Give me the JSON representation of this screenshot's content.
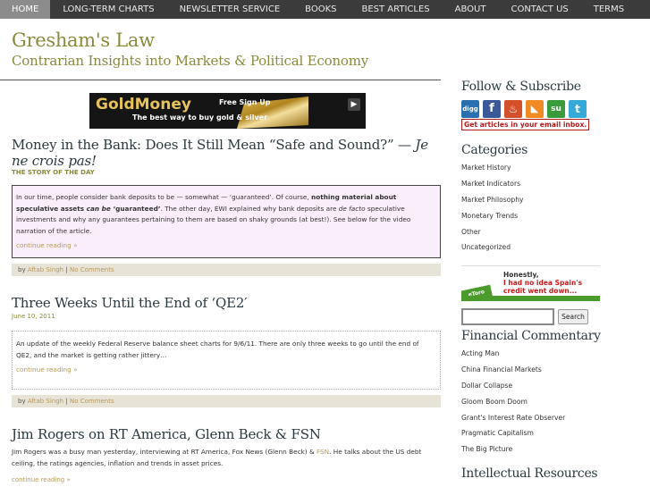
{
  "nav": {
    "items": [
      {
        "label": "HOME"
      },
      {
        "label": "LONG-TERM CHARTS"
      },
      {
        "label": "NEWSLETTER SERVICE"
      },
      {
        "label": "BOOKS"
      },
      {
        "label": "BEST ARTICLES"
      },
      {
        "label": "ABOUT"
      },
      {
        "label": "CONTACT US"
      },
      {
        "label": "TERMS"
      }
    ],
    "active_index": 0
  },
  "site": {
    "title": "Gresham's Law",
    "tagline": "Contrarian Insights into Markets & Political Economy"
  },
  "banner": {
    "logo": "GoldMoney",
    "signup": "Free Sign Up",
    "tagline": "The best way to buy gold & silver"
  },
  "posts": [
    {
      "title_main": "Money in the Bank: Does It Still Mean “Safe and Sound?” — ",
      "title_em": "Je ne crois pas!",
      "sub": "THE STORY OF THE DAY",
      "excerpt_parts": [
        "In our time, people consider bank deposits to be — somewhat — ‘guaranteed’. Of course, ",
        "nothing material about speculative assets ",
        "can be",
        " ‘guaranteed’",
        ". The other day, EWI explained why bank deposits are ",
        "de facto",
        " speculative investments and why any guarantees pertaining to them are based on shaky grounds (at best!). See below for the video narration of the article."
      ],
      "more": "continue reading »",
      "author": "Aftab Singh",
      "comments": "No Comments"
    },
    {
      "title_main": "Three Weeks Until the End of ‘QE2′",
      "sub": "June 10, 2011",
      "excerpt": "An update of the weekly Federal Reserve balance sheet charts for 9/6/11. There are only three weeks to go until the end of QE2, and the market is getting rather jittery…",
      "more": "continue reading »",
      "author": "Aftab Singh",
      "comments": "No Comments"
    },
    {
      "title_main": "Jim Rogers on RT America, Glenn Beck & FSN",
      "text_before": "Jim Rogers was a busy man yesterday, interviewing at RT America, Fox News (Glenn Beck) & ",
      "text_link": "FSN",
      "text_after": ". He talks about the US debt ceiling, the ratings agencies, inflation and trends in asset prices.",
      "more": "continue reading »"
    }
  ],
  "meta": {
    "by": "by",
    "separator": "|"
  },
  "sidebar": {
    "follow_heading": "Follow & Subscribe",
    "social": [
      {
        "name": "digg-icon",
        "glyph": "digg",
        "color": "#2a6fb0"
      },
      {
        "name": "facebook-icon",
        "glyph": "f",
        "color": "#3b5998"
      },
      {
        "name": "stumble-flame-icon",
        "glyph": "♨",
        "color": "#d3502b"
      },
      {
        "name": "rss-icon",
        "glyph": "◣",
        "color": "#f08a24"
      },
      {
        "name": "stumbleupon-icon",
        "glyph": "su",
        "color": "#3a9b3a"
      },
      {
        "name": "twitter-icon",
        "glyph": "t",
        "color": "#35a9d8"
      }
    ],
    "email_link": "Get articles in your email inbox.",
    "categories_heading": "Categories",
    "categories": [
      "Market History",
      "Market Indicators",
      "Market Philosophy",
      "Monetary Trends",
      "Other",
      "Uncategorized"
    ],
    "ad": {
      "line1": "Honestly,",
      "line2": "I had no idea Spain's credit went down...",
      "brand": "eToro"
    },
    "search": {
      "placeholder": "",
      "button": "Search"
    },
    "commentary_heading": "Financial Commentary",
    "commentary": [
      "Acting Man",
      "China Financial Markets",
      "Dollar Collapse",
      "Gloom Boom Doom",
      "Grant's Interest Rate Observer",
      "Pragmatic Capitalism",
      "The Big Picture"
    ],
    "resources_heading": "Intellectual Resources"
  },
  "colors": {
    "accent": "#8a8a3c",
    "link": "#b89a5a",
    "nav_bg": "#3b3b3b",
    "alert": "#b21b1b"
  }
}
